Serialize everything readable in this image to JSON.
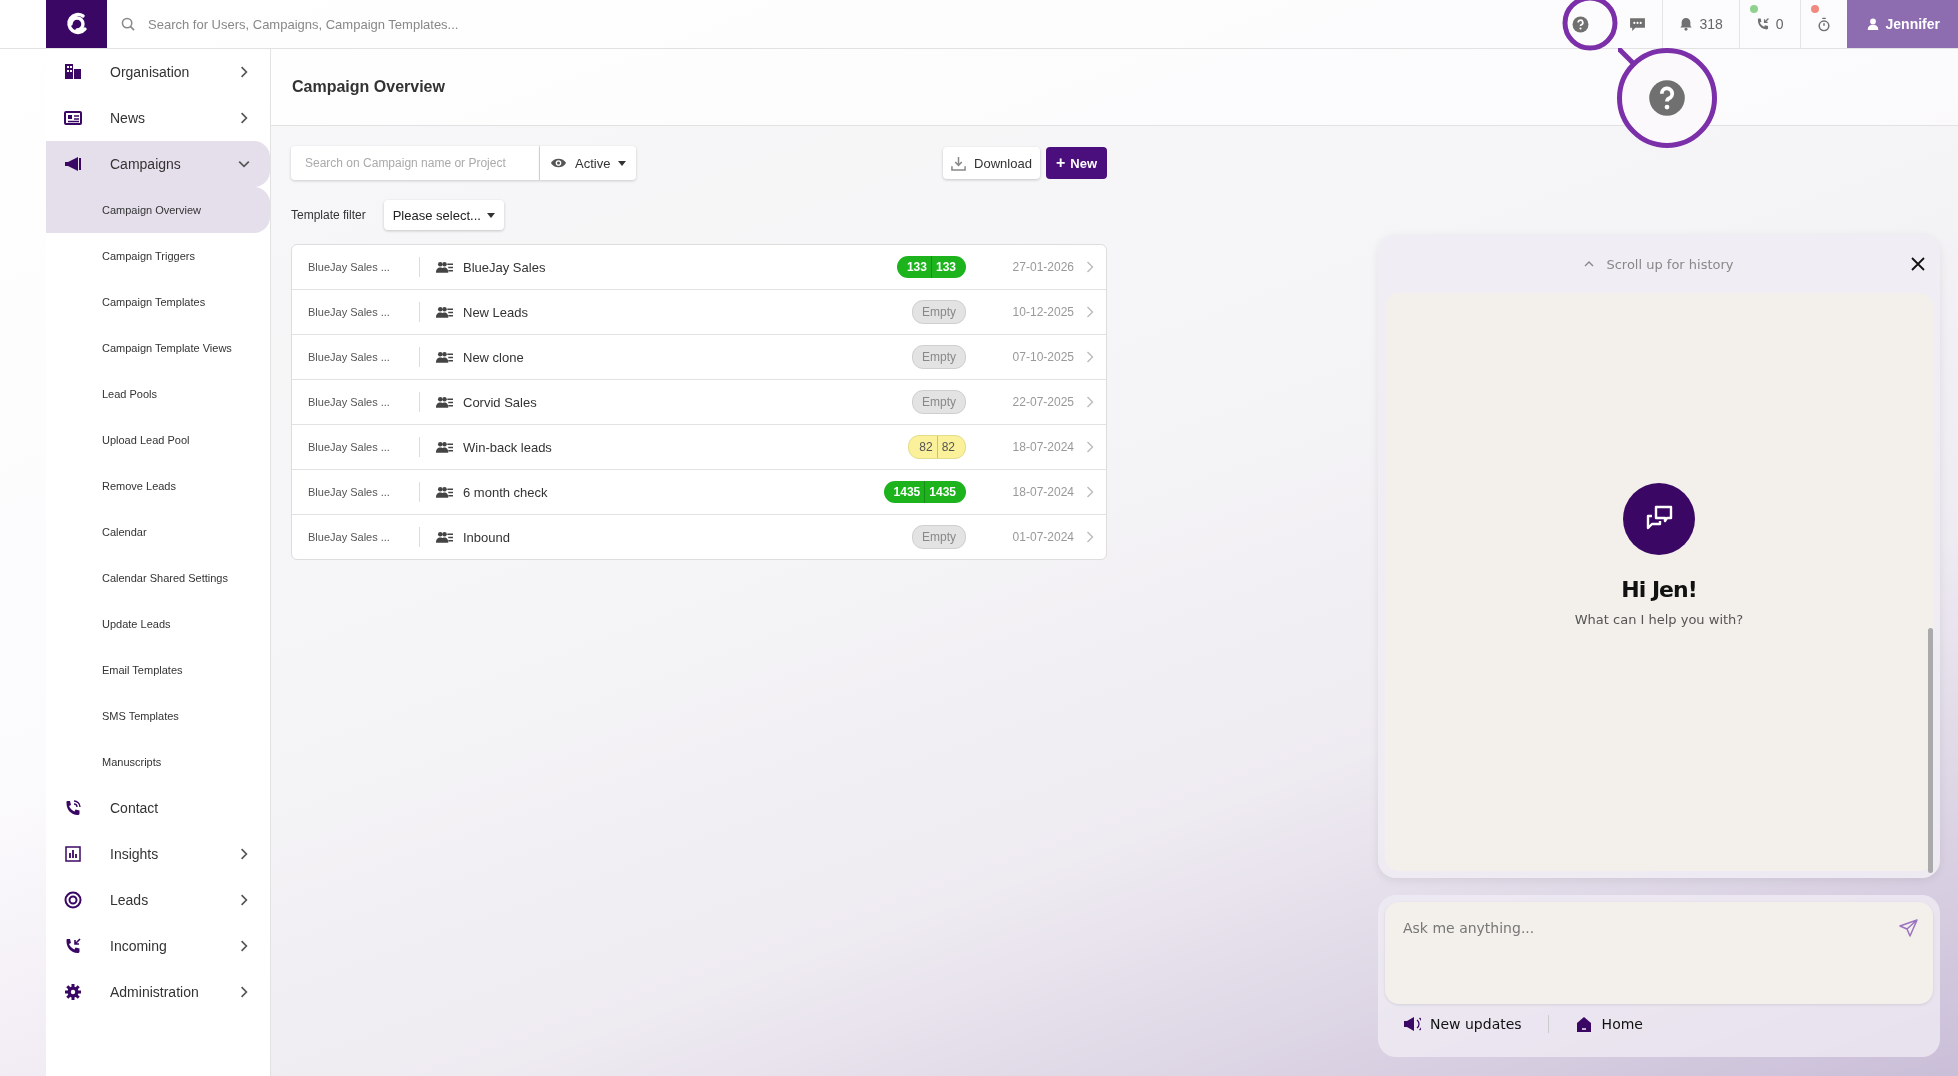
{
  "topbar": {
    "search_placeholder": "Search for Users, Campaigns, Campaign Templates...",
    "notifications": "318",
    "calls": "0",
    "status_dots": [
      {
        "color": "#8fd18f"
      },
      {
        "color": "#f08a80"
      }
    ],
    "user": "Jennifer"
  },
  "sidebar": {
    "items": [
      {
        "label": "Organisation",
        "kind": "group",
        "expanded": false,
        "selected": false
      },
      {
        "label": "News",
        "kind": "group",
        "expanded": false,
        "selected": false
      },
      {
        "label": "Campaigns",
        "kind": "group",
        "expanded": true,
        "selected": true,
        "children": [
          {
            "label": "Campaign Overview",
            "selected": true
          },
          {
            "label": "Campaign Triggers",
            "selected": false
          },
          {
            "label": "Campaign Templates",
            "selected": false
          },
          {
            "label": "Campaign Template Views",
            "selected": false
          },
          {
            "label": "Lead Pools",
            "selected": false
          },
          {
            "label": "Upload Lead Pool",
            "selected": false
          },
          {
            "label": "Remove Leads",
            "selected": false
          },
          {
            "label": "Calendar",
            "selected": false
          },
          {
            "label": "Calendar Shared Settings",
            "selected": false
          },
          {
            "label": "Update Leads",
            "selected": false
          },
          {
            "label": "Email Templates",
            "selected": false
          },
          {
            "label": "SMS Templates",
            "selected": false
          },
          {
            "label": "Manuscripts",
            "selected": false
          }
        ]
      },
      {
        "label": "Contact",
        "kind": "link",
        "expanded": false,
        "selected": false
      },
      {
        "label": "Insights",
        "kind": "group",
        "expanded": false,
        "selected": false
      },
      {
        "label": "Leads",
        "kind": "group",
        "expanded": false,
        "selected": false
      },
      {
        "label": "Incoming",
        "kind": "group",
        "expanded": false,
        "selected": false
      },
      {
        "label": "Administration",
        "kind": "group",
        "expanded": false,
        "selected": false
      }
    ]
  },
  "page": {
    "title": "Campaign Overview",
    "search_placeholder": "Search on Campaign name or Project",
    "visibility": "Active",
    "download": "Download",
    "new": "New",
    "new_icon": "+",
    "template_filter_label": "Template filter",
    "template_filter": "Please select...",
    "rows": [
      {
        "project": "BlueJay Sales ...",
        "name": "BlueJay Sales",
        "status": {
          "kind": "count",
          "color": "#1db31d",
          "values": [
            "133",
            "133"
          ]
        },
        "date": "27-01-2026"
      },
      {
        "project": "BlueJay Sales ...",
        "name": "New Leads",
        "status": {
          "kind": "empty",
          "label": "Empty"
        },
        "date": "10-12-2025"
      },
      {
        "project": "BlueJay Sales ...",
        "name": "New clone",
        "status": {
          "kind": "empty",
          "label": "Empty"
        },
        "date": "07-10-2025"
      },
      {
        "project": "BlueJay Sales ...",
        "name": "Corvid Sales",
        "status": {
          "kind": "empty",
          "label": "Empty"
        },
        "date": "22-07-2025"
      },
      {
        "project": "BlueJay Sales ...",
        "name": "Win-back leads",
        "status": {
          "kind": "count",
          "color": "#faf19a",
          "values": [
            "82",
            "82"
          ]
        },
        "date": "18-07-2024"
      },
      {
        "project": "BlueJay Sales ...",
        "name": "6 month check",
        "status": {
          "kind": "count",
          "color": "#1db31d",
          "values": [
            "1435",
            "1435"
          ]
        },
        "date": "18-07-2024"
      },
      {
        "project": "BlueJay Sales ...",
        "name": "Inbound",
        "status": {
          "kind": "empty",
          "label": "Empty"
        },
        "date": "01-07-2024"
      }
    ]
  },
  "chat": {
    "scroll_hint": "Scroll up for history",
    "greeting": "Hi Jen!",
    "subtitle": "What can I help you with?",
    "placeholder": "Ask me anything...",
    "links": [
      "New updates",
      "Home"
    ]
  }
}
